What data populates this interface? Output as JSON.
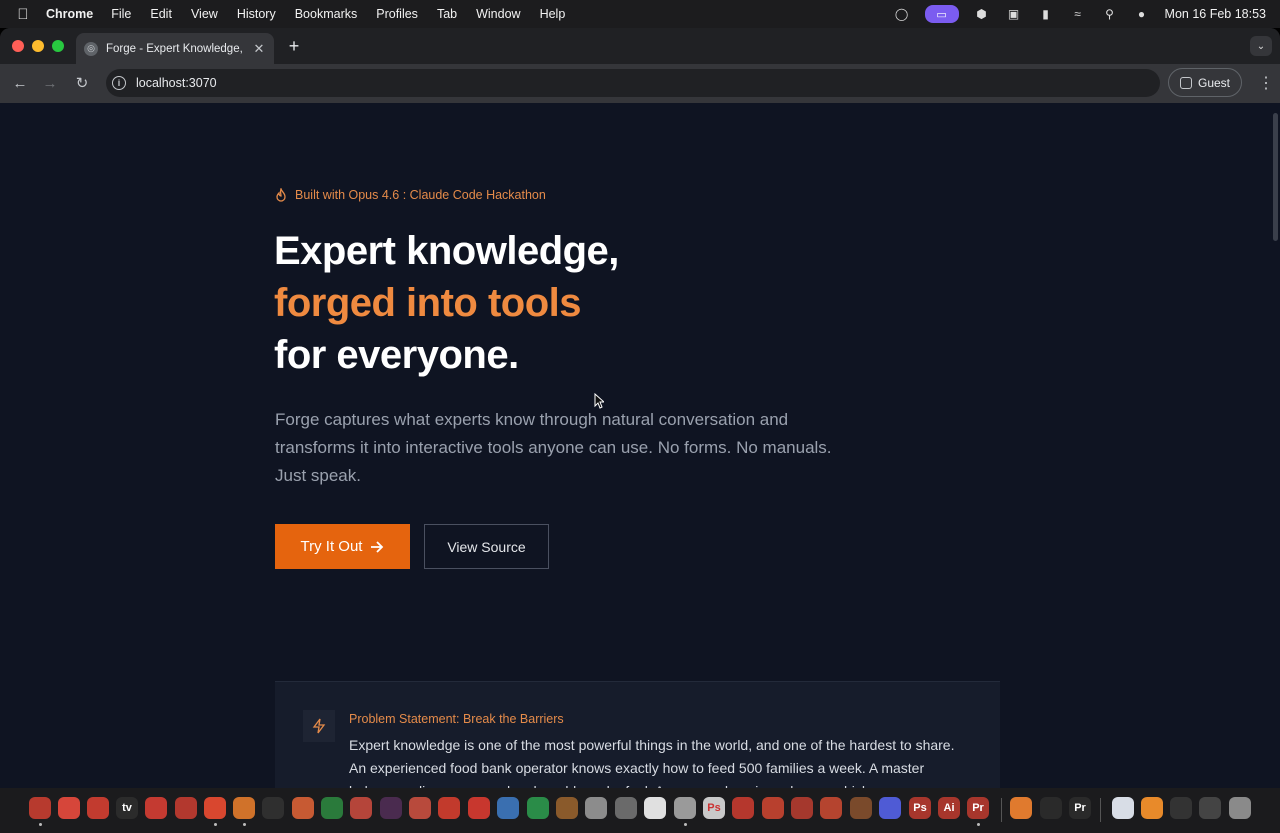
{
  "menubar": {
    "apple_icon": "apple-logo",
    "app_name": "Chrome",
    "items": [
      "File",
      "Edit",
      "View",
      "History",
      "Bookmarks",
      "Profiles",
      "Tab",
      "Window",
      "Help"
    ],
    "clock": "Mon 16 Feb  18:53"
  },
  "browser": {
    "tab_title": "Forge - Expert Knowledge, Fo",
    "url": "localhost:3070",
    "profile_label": "Guest"
  },
  "page": {
    "badge": "Built with Opus 4.6 : Claude Code Hackathon",
    "headline_line1": "Expert knowledge,",
    "headline_line2": "forged into tools",
    "headline_line3": "for everyone.",
    "subtitle": "Forge captures what experts know through natural conversation and transforms it into interactive tools anyone can use. No forms. No manuals. Just speak.",
    "primary_button": "Try It Out",
    "secondary_button": "View Source",
    "problem_title": "Problem Statement: Break the Barriers",
    "problem_body": "Expert knowledge is one of the most powerful things in the world, and one of the hardest to share. An experienced food bank operator knows exactly how to feed 500 families a week. A master baker can diagnose sourdough problems by feel. A seasoned engineer knows which"
  },
  "colors": {
    "page_bg": "#0f1422",
    "accent": "#ef8a40",
    "primary_button": "#e5640e"
  },
  "dock": {
    "labels": [
      "tv",
      "Ps",
      "Ai",
      "Pr",
      "Ps",
      "Ai",
      "Pr",
      "Pr"
    ]
  }
}
